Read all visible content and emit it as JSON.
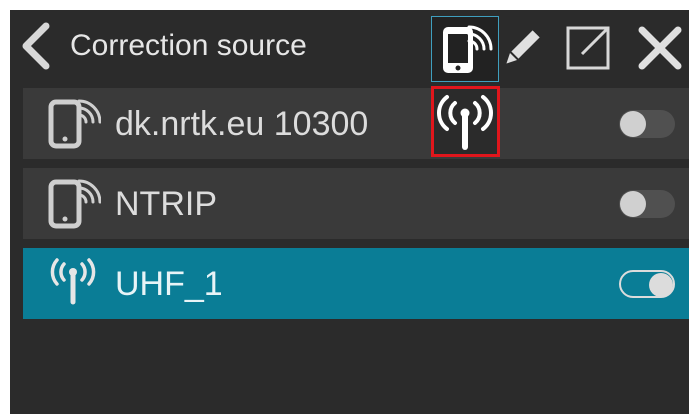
{
  "header": {
    "title": "Correction source",
    "back_icon": "chevron-left-icon",
    "buttons": [
      {
        "icon": "phone-signal-icon",
        "selected": true
      },
      {
        "icon": "pencil-icon"
      },
      {
        "icon": "external-link-icon"
      },
      {
        "icon": "close-icon"
      }
    ]
  },
  "popup": {
    "icon": "radio-antenna-icon",
    "highlight_color": "#e0161c"
  },
  "sources": [
    {
      "label": "dk.nrtk.eu 10300",
      "icon": "phone-signal-icon",
      "enabled": false,
      "active": false
    },
    {
      "label": "NTRIP",
      "icon": "phone-signal-icon",
      "enabled": false,
      "active": false
    },
    {
      "label": "UHF_1",
      "icon": "radio-antenna-icon",
      "enabled": true,
      "active": true
    }
  ],
  "colors": {
    "background": "#2b2b2b",
    "row": "#3a3a3a",
    "accent": "#0a7d96",
    "text": "#e6e6e6"
  }
}
